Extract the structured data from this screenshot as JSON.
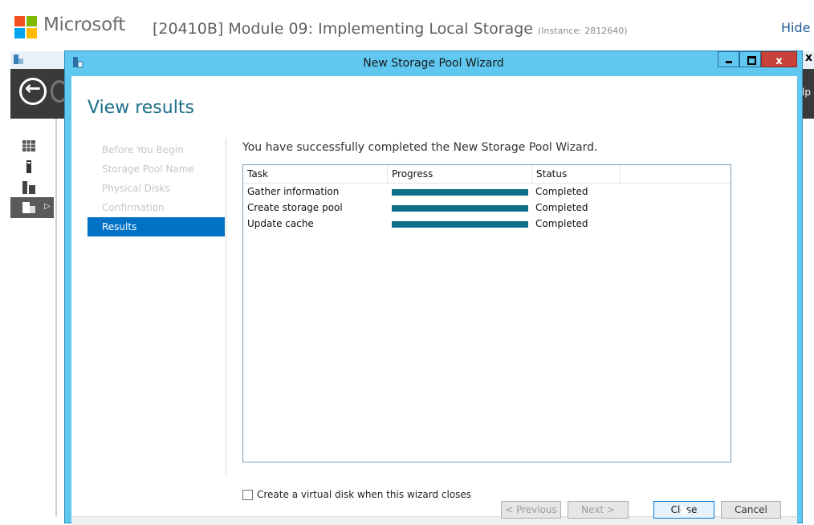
{
  "portal": {
    "logo_text": "Microsoft",
    "lab_title": "[20410B] Module 09: Implementing Local Storage",
    "instance": "(Instance: 2812640)",
    "hide_link": "Hide r"
  },
  "server_manager": {
    "help_fragment": "lp",
    "close_glyph": "x"
  },
  "wizard": {
    "title": "New Storage Pool Wizard",
    "page_heading": "View results",
    "steps": [
      {
        "label": "Before You Begin",
        "active": false
      },
      {
        "label": "Storage Pool Name",
        "active": false
      },
      {
        "label": "Physical Disks",
        "active": false
      },
      {
        "label": "Confirmation",
        "active": false
      },
      {
        "label": "Results",
        "active": true
      }
    ],
    "success_message": "You have successfully completed the New Storage Pool Wizard.",
    "table": {
      "headers": {
        "task": "Task",
        "progress": "Progress",
        "status": "Status"
      },
      "rows": [
        {
          "task": "Gather information",
          "progress": 1.0,
          "status": "Completed"
        },
        {
          "task": "Create storage pool",
          "progress": 1.0,
          "status": "Completed"
        },
        {
          "task": "Update cache",
          "progress": 1.0,
          "status": "Completed"
        }
      ]
    },
    "virtual_disk_checkbox": {
      "label": "Create a virtual disk when this wizard closes",
      "checked": false
    },
    "buttons": {
      "previous": "< Previous",
      "next": "Next >",
      "close": "Close",
      "cancel": "Cancel"
    },
    "window_controls": {
      "close": "x"
    }
  },
  "colors": {
    "accent_blue": "#0072c6",
    "progress_fill": "#0f6f8a",
    "title_bar": "#5fc7f0",
    "close_button": "#c74339"
  }
}
